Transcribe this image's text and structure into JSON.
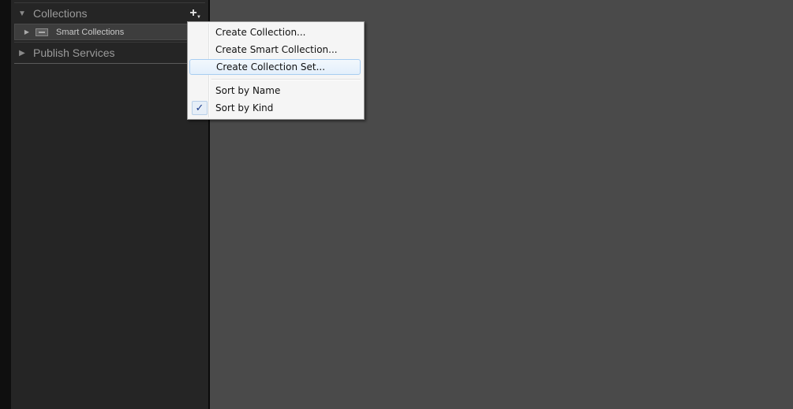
{
  "panel": {
    "collections_header": "Collections",
    "publish_header": "Publish Services",
    "add_button_glyph": "+",
    "items": [
      {
        "label": "Smart Collections",
        "icon": "collection-set-icon"
      }
    ]
  },
  "context_menu": {
    "items": [
      {
        "label": "Create Collection..."
      },
      {
        "label": "Create Smart Collection..."
      },
      {
        "label": "Create Collection Set...",
        "highlighted": true
      },
      {
        "label": "Sort by Name"
      },
      {
        "label": "Sort by Kind",
        "checked": true
      }
    ],
    "check_glyph": "✓"
  },
  "colors": {
    "panel_bg": "#252525",
    "main_bg": "#4a4a4a",
    "menu_bg": "#f5f5f5",
    "highlight_border": "#a8cdf1"
  }
}
